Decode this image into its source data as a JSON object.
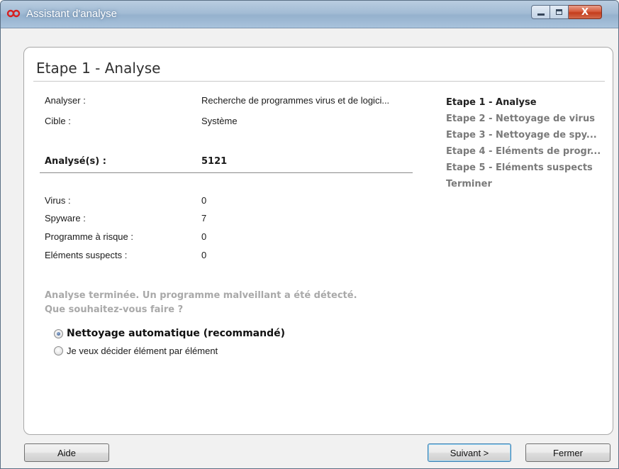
{
  "window": {
    "title": "Assistant d'analyse",
    "icon": "infinity-logo-icon",
    "accent_color": "#d62020"
  },
  "controls": {
    "minimize": "minimize-icon",
    "maximize": "maximize-icon",
    "close": "close-icon",
    "close_glyph": "X"
  },
  "step_heading": "Etape 1 - Analyse",
  "details": {
    "analyser_label": "Analyser :",
    "analyser_value": "Recherche de programmes virus et de logici...",
    "cible_label": "Cible :",
    "cible_value": "Système",
    "analyses_label": "Analysé(s) :",
    "analyses_value": "5121"
  },
  "results": [
    {
      "label": "Virus :",
      "value": "0"
    },
    {
      "label": "Spyware :",
      "value": "7"
    },
    {
      "label": "Programme à risque :",
      "value": "0"
    },
    {
      "label": "Eléments suspects :",
      "value": "0"
    }
  ],
  "steps": [
    {
      "label": "Etape 1 - Analyse",
      "active": true
    },
    {
      "label": "Etape 2 - Nettoyage de virus",
      "active": false
    },
    {
      "label": "Etape 3 - Nettoyage de spy...",
      "active": false
    },
    {
      "label": "Etape 4 - Eléments de progr...",
      "active": false
    },
    {
      "label": "Etape 5 - Eléments suspects",
      "active": false
    },
    {
      "label": "Terminer",
      "active": false
    }
  ],
  "status": {
    "line1": "Analyse terminée. Un programme malveillant a été détecté.",
    "line2": "Que souhaitez-vous faire ?"
  },
  "options": {
    "auto_label": "Nettoyage automatique (recommandé)",
    "auto_checked": true,
    "manual_label": "Je veux décider élément par élément",
    "manual_checked": false
  },
  "buttons": {
    "help": "Aide",
    "next": "Suivant >",
    "close": "Fermer"
  }
}
